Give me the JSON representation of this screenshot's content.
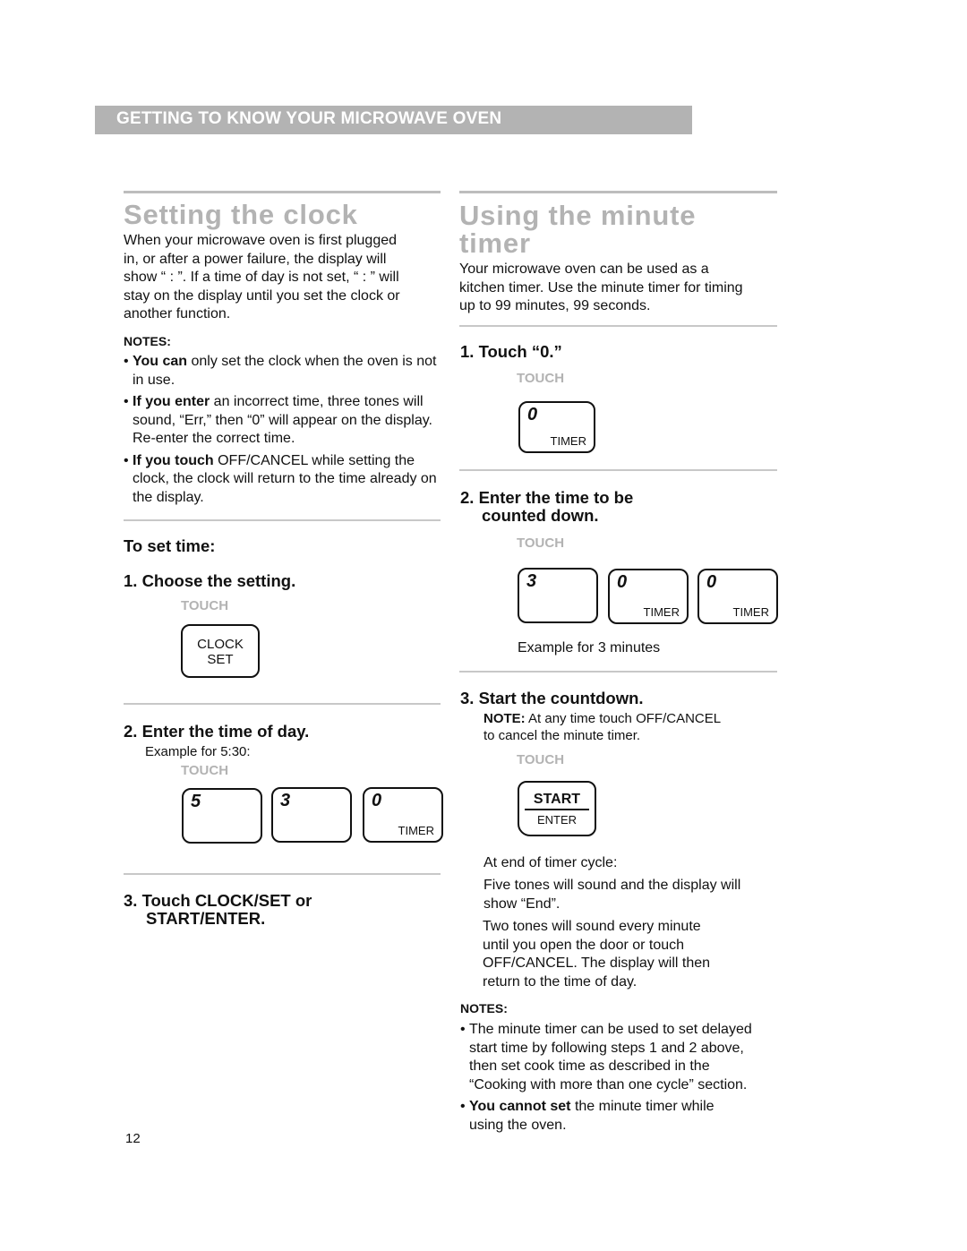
{
  "header": {
    "banner": "GETTING TO KNOW YOUR MICROWAVE OVEN"
  },
  "left": {
    "title": "Setting the clock",
    "intro_lines": [
      "When your microwave oven is first plugged",
      "in, or after a power failure, the display will",
      "show “ : ”. If a time of day is not set, “ : ” will",
      "stay on the display until you set the clock or",
      "another function."
    ],
    "notes_heading": "NOTES:",
    "notes": [
      {
        "bold": "You can",
        "text": " only set the clock when the oven is not in use."
      },
      {
        "bold": "If you enter",
        "text": " an incorrect time, three tones will sound, “Err,” then “0” will appear on the display. Re-enter the correct time."
      },
      {
        "bold": "If you touch",
        "text": " OFF/CANCEL while setting the clock, the clock will return to the time already on the display."
      }
    ],
    "to_set": "To set time:",
    "step1": "1. Choose the setting.",
    "touch": "TOUCH",
    "clock_key": {
      "line1": "CLOCK",
      "line2": "SET"
    },
    "step2": "2. Enter the time of day.",
    "step2_example": "Example for 5:30:",
    "keys_530": [
      {
        "num": "5",
        "label": ""
      },
      {
        "num": "3",
        "label": ""
      },
      {
        "num": "0",
        "label": "TIMER"
      }
    ],
    "step3_line1": "3. Touch CLOCK/SET or",
    "step3_line2": "START/ENTER."
  },
  "right": {
    "title_line1": "Using the minute",
    "title_line2": "timer",
    "intro_lines": [
      "Your microwave oven can be used as a",
      "kitchen timer. Use the minute timer for timing",
      "up to 99 minutes, 99 seconds."
    ],
    "step1": "1. Touch “0.”",
    "touch": "TOUCH",
    "key0": {
      "num": "0",
      "label": "TIMER"
    },
    "step2_line1": "2. Enter the time to be",
    "step2_line2": "counted down.",
    "keys_300": [
      {
        "num": "3",
        "label": ""
      },
      {
        "num": "0",
        "label": "TIMER"
      },
      {
        "num": "0",
        "label": "TIMER"
      }
    ],
    "example3": "Example for 3 minutes",
    "step3": "3. Start the countdown.",
    "step3_note_bold": "NOTE:",
    "step3_note_line1": " At any time touch OFF/CANCEL",
    "step3_note_line2": "to cancel the minute timer.",
    "start_key": {
      "top": "START",
      "bottom": "ENTER"
    },
    "end_heading": "At end of timer cycle:",
    "end_p1_lines": [
      "Five tones will sound and the display will",
      "show “End”."
    ],
    "end_p2_lines": [
      "Two tones will sound every minute",
      "until you open the door or touch",
      "OFF/CANCEL. The display will then",
      "return to the time of day."
    ],
    "notes_heading": "NOTES:",
    "notes": [
      {
        "bold": "",
        "lines": [
          "The minute timer can be used to set delayed",
          "start time by following steps 1 and 2 above,",
          "then set cook time as described in the",
          "“Cooking with more than one cycle” section."
        ]
      },
      {
        "bold": "You cannot set",
        "lines": [
          " the minute timer while",
          "using the oven."
        ]
      }
    ]
  },
  "footer": {
    "page_number": "12"
  }
}
